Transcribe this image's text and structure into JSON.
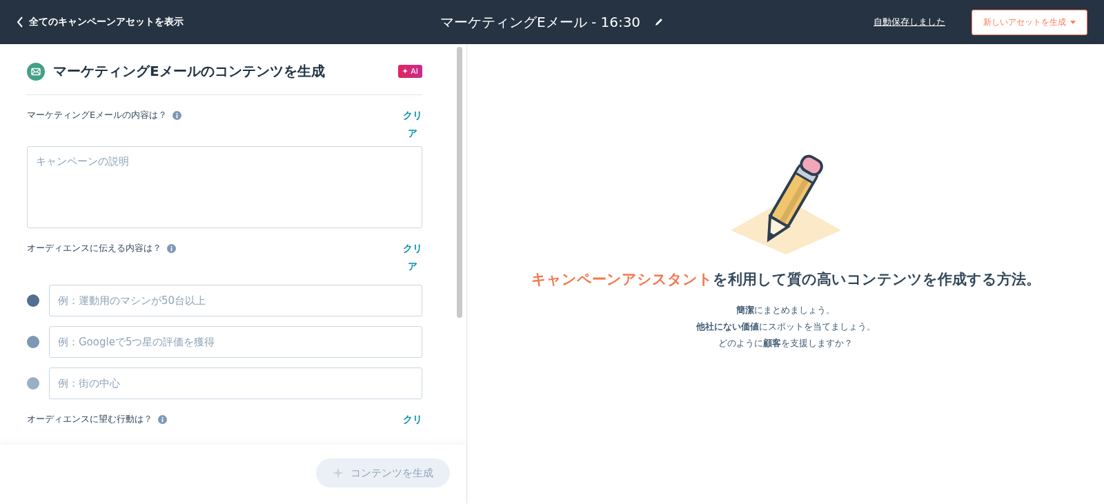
{
  "header": {
    "back_link": "全てのキャンペーンアセットを表示",
    "title": "マーケティングEメール - 16:30",
    "autosave": "自動保存しました",
    "new_asset_button": "新しいアセットを生成"
  },
  "panel": {
    "title": "マーケティングEメールのコンテンツを生成",
    "ai_badge": "✦ AI",
    "sections": [
      {
        "kind": "textarea",
        "label": "マーケティングEメールの内容は？",
        "clear": "クリア",
        "placeholder": "キャンペーンの説明"
      },
      {
        "kind": "bullets",
        "label": "オーディエンスに伝える内容は？",
        "clear": "クリア",
        "items": [
          {
            "placeholder": "例：運動用のマシンが50台以上",
            "color": "#516f90"
          },
          {
            "placeholder": "例：Googleで5つ星の評価を獲得",
            "color": "#7c98b6"
          },
          {
            "placeholder": "例：街の中心",
            "color": "#99afc4"
          }
        ]
      },
      {
        "kind": "label_only",
        "label": "オーディエンスに望む行動は？",
        "clear": "クリ"
      }
    ],
    "generate_button": {
      "label": "コンテンツを生成",
      "disabled": true
    }
  },
  "assistant": {
    "heading_highlight": "キャンペーンアシスタント",
    "heading_rest": "を利用して質の高いコンテンツを作成する方法。",
    "tips": [
      "**簡潔**にまとめましょう。",
      "**他社にない価値**にスポットを当てましょう。",
      "どのように**顧客**を支援しますか？"
    ]
  }
}
